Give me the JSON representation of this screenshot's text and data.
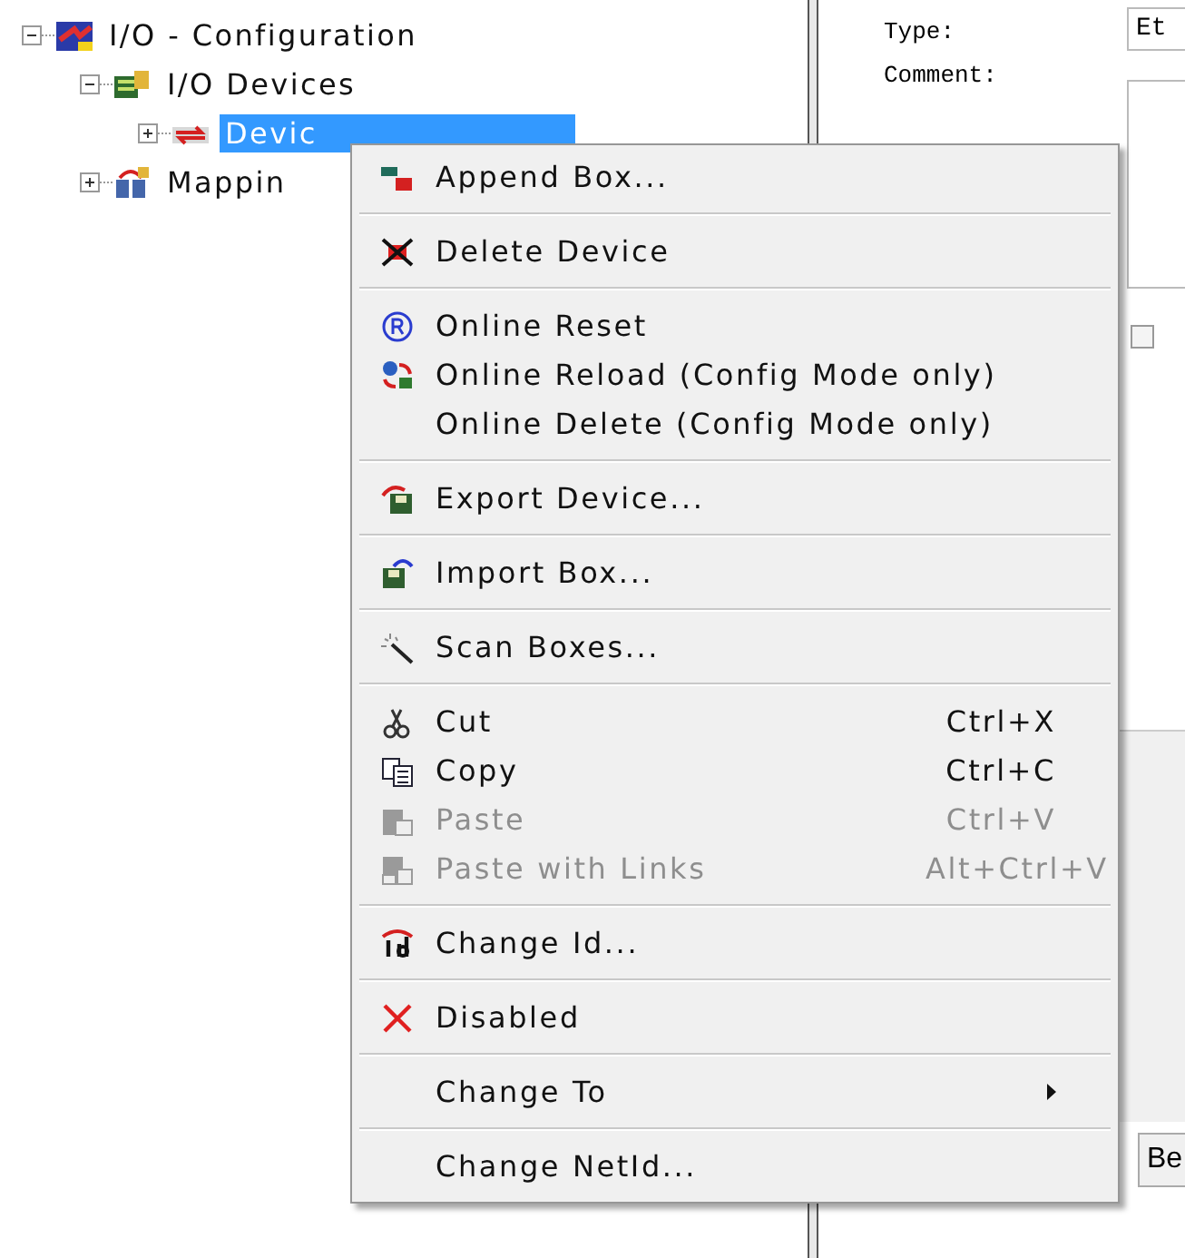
{
  "tree": [
    {
      "label": "I/O - Configuration",
      "kind": "config",
      "expanded": true,
      "selected": false,
      "children": [
        {
          "label": "I/O Devices",
          "kind": "devices",
          "expanded": true,
          "selected": false,
          "children": [
            {
              "label": "Devic",
              "kind": "device",
              "expanded": false,
              "selected": true
            }
          ]
        },
        {
          "label": "Mappin",
          "kind": "mapping",
          "expanded": false,
          "selected": false
        }
      ]
    }
  ],
  "details": {
    "type_label": "Type:",
    "type_value": "Et",
    "comment_label": "Comment:",
    "checkbox": {
      "checked": false
    },
    "button": "Be"
  },
  "context_menu": {
    "groups": [
      [
        {
          "kind": "append",
          "label": "Append Box...",
          "disabled": false
        }
      ],
      [
        {
          "kind": "delete",
          "label": "Delete Device",
          "disabled": false
        }
      ],
      [
        {
          "kind": "reset",
          "label": "Online Reset",
          "disabled": false
        },
        {
          "kind": "reload",
          "label": "Online Reload (Config Mode only)",
          "disabled": false
        },
        {
          "kind": "plain",
          "label": "Online Delete (Config Mode only)",
          "disabled": false
        }
      ],
      [
        {
          "kind": "export",
          "label": "Export Device...",
          "disabled": false
        }
      ],
      [
        {
          "kind": "import",
          "label": "Import Box...",
          "disabled": false
        }
      ],
      [
        {
          "kind": "scan",
          "label": "Scan Boxes...",
          "disabled": false
        }
      ],
      [
        {
          "kind": "cut",
          "label": "Cut",
          "shortcut": "Ctrl+X",
          "disabled": false
        },
        {
          "kind": "copy",
          "label": "Copy",
          "shortcut": "Ctrl+C",
          "disabled": false
        },
        {
          "kind": "paste",
          "label": "Paste",
          "shortcut": "Ctrl+V",
          "disabled": true
        },
        {
          "kind": "paste-links",
          "label": "Paste with Links",
          "shortcut": "Alt+Ctrl+V",
          "disabled": true
        }
      ],
      [
        {
          "kind": "change-id",
          "label": "Change Id...",
          "disabled": false
        }
      ],
      [
        {
          "kind": "disable",
          "label": "Disabled",
          "disabled": false
        }
      ],
      [
        {
          "kind": "plain",
          "label": "Change To",
          "submenu": true,
          "disabled": false
        }
      ],
      [
        {
          "kind": "plain",
          "label": "Change NetId...",
          "disabled": false
        }
      ]
    ]
  }
}
